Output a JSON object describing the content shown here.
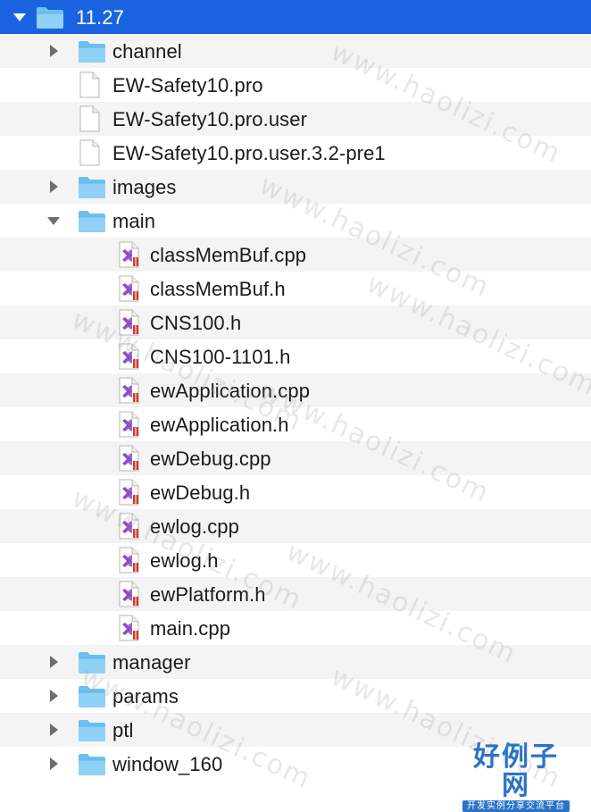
{
  "tree": [
    {
      "label": "11.27",
      "kind": "folder",
      "depth": 0,
      "state": "expanded",
      "selected": true
    },
    {
      "label": "channel",
      "kind": "folder",
      "depth": 1,
      "state": "collapsed"
    },
    {
      "label": "EW-Safety10.pro",
      "kind": "file",
      "depth": 1
    },
    {
      "label": "EW-Safety10.pro.user",
      "kind": "file",
      "depth": 1
    },
    {
      "label": "EW-Safety10.pro.user.3.2-pre1",
      "kind": "file",
      "depth": 1
    },
    {
      "label": "images",
      "kind": "folder",
      "depth": 1,
      "state": "collapsed"
    },
    {
      "label": "main",
      "kind": "folder",
      "depth": 1,
      "state": "expanded"
    },
    {
      "label": "classMemBuf.cpp",
      "kind": "vs-file",
      "depth": 2
    },
    {
      "label": "classMemBuf.h",
      "kind": "vs-file",
      "depth": 2
    },
    {
      "label": "CNS100.h",
      "kind": "vs-file",
      "depth": 2
    },
    {
      "label": "CNS100-1101.h",
      "kind": "vs-file",
      "depth": 2
    },
    {
      "label": "ewApplication.cpp",
      "kind": "vs-file",
      "depth": 2
    },
    {
      "label": "ewApplication.h",
      "kind": "vs-file",
      "depth": 2
    },
    {
      "label": "ewDebug.cpp",
      "kind": "vs-file",
      "depth": 2
    },
    {
      "label": "ewDebug.h",
      "kind": "vs-file",
      "depth": 2
    },
    {
      "label": "ewlog.cpp",
      "kind": "vs-file",
      "depth": 2
    },
    {
      "label": "ewlog.h",
      "kind": "vs-file",
      "depth": 2
    },
    {
      "label": "ewPlatform.h",
      "kind": "vs-file",
      "depth": 2
    },
    {
      "label": "main.cpp",
      "kind": "vs-file",
      "depth": 2
    },
    {
      "label": "manager",
      "kind": "folder",
      "depth": 1,
      "state": "collapsed"
    },
    {
      "label": "params",
      "kind": "folder",
      "depth": 1,
      "state": "collapsed"
    },
    {
      "label": "ptl",
      "kind": "folder",
      "depth": 1,
      "state": "collapsed"
    },
    {
      "label": "window_160",
      "kind": "folder",
      "depth": 1,
      "state": "collapsed"
    }
  ],
  "watermark": "www.haolizi.com",
  "logo": {
    "main": "好例子网",
    "sub": "开发实例分享交流平台"
  },
  "colors": {
    "selection": "#1a63e0",
    "folder": "#6cc0f2",
    "vs_purple": "#8a4fc7",
    "vs_red": "#d23a2e"
  },
  "icons": {
    "folder": "folder-icon",
    "file": "file-icon",
    "vs-file": "visual-studio-file-icon",
    "collapsed": "disclosure-triangle-right-icon",
    "expanded": "disclosure-triangle-down-icon"
  }
}
